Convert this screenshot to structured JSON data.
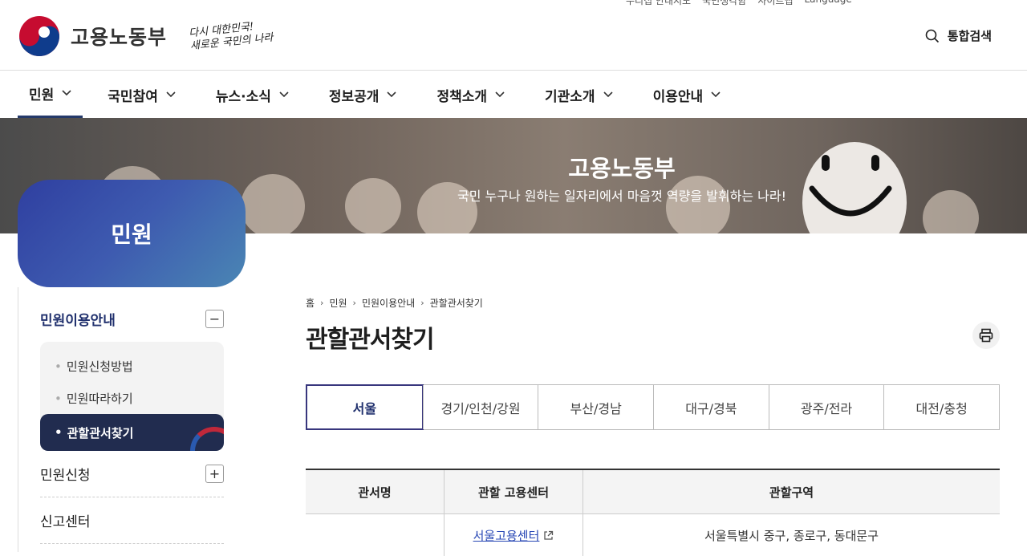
{
  "header": {
    "logo_text": "고용노동부",
    "slogan_line1": "다시 대한민국!",
    "slogan_line2": "새로운 국민의 나라",
    "search_label": "통합검색",
    "util_links": [
      "누리집 안내지도",
      "국민생각함",
      "사이트맵",
      "Language"
    ]
  },
  "gnb": [
    {
      "label": "민원"
    },
    {
      "label": "국민참여"
    },
    {
      "label": "뉴스·소식"
    },
    {
      "label": "정보공개"
    },
    {
      "label": "정책소개"
    },
    {
      "label": "기관소개"
    },
    {
      "label": "이용안내"
    }
  ],
  "banner": {
    "title": "고용노동부",
    "subtitle": "국민 누구나 원하는 일자리에서 마음껏 역량을 발휘하는 나라!"
  },
  "side": {
    "title": "민원",
    "sections": [
      {
        "label": "민원이용안내",
        "toggle": "−"
      },
      {
        "label": "민원신청",
        "toggle": "+"
      },
      {
        "label": "신고센터"
      }
    ],
    "sub_items": [
      {
        "label": "민원신청방법"
      },
      {
        "label": "민원따라하기"
      },
      {
        "label": "관할관서찾기"
      }
    ]
  },
  "breadcrumb": [
    "홈",
    "민원",
    "민원이용안내",
    "관할관서찾기"
  ],
  "page_title": "관할관서찾기",
  "tabs": [
    {
      "label": "서울"
    },
    {
      "label": "경기/인천/강원"
    },
    {
      "label": "부산/경남"
    },
    {
      "label": "대구/경북"
    },
    {
      "label": "광주/전라"
    },
    {
      "label": "대전/충청"
    }
  ],
  "table": {
    "headers": [
      "관서명",
      "관할 고용센터",
      "관할구역"
    ],
    "rows": [
      {
        "office": "",
        "center": "서울고용센터",
        "area": "서울특별시 중구, 종로구, 동대문구"
      }
    ]
  },
  "colors": {
    "accent": "#253a6a",
    "active_tab_border": "#38367d",
    "link": "#2646b4"
  }
}
